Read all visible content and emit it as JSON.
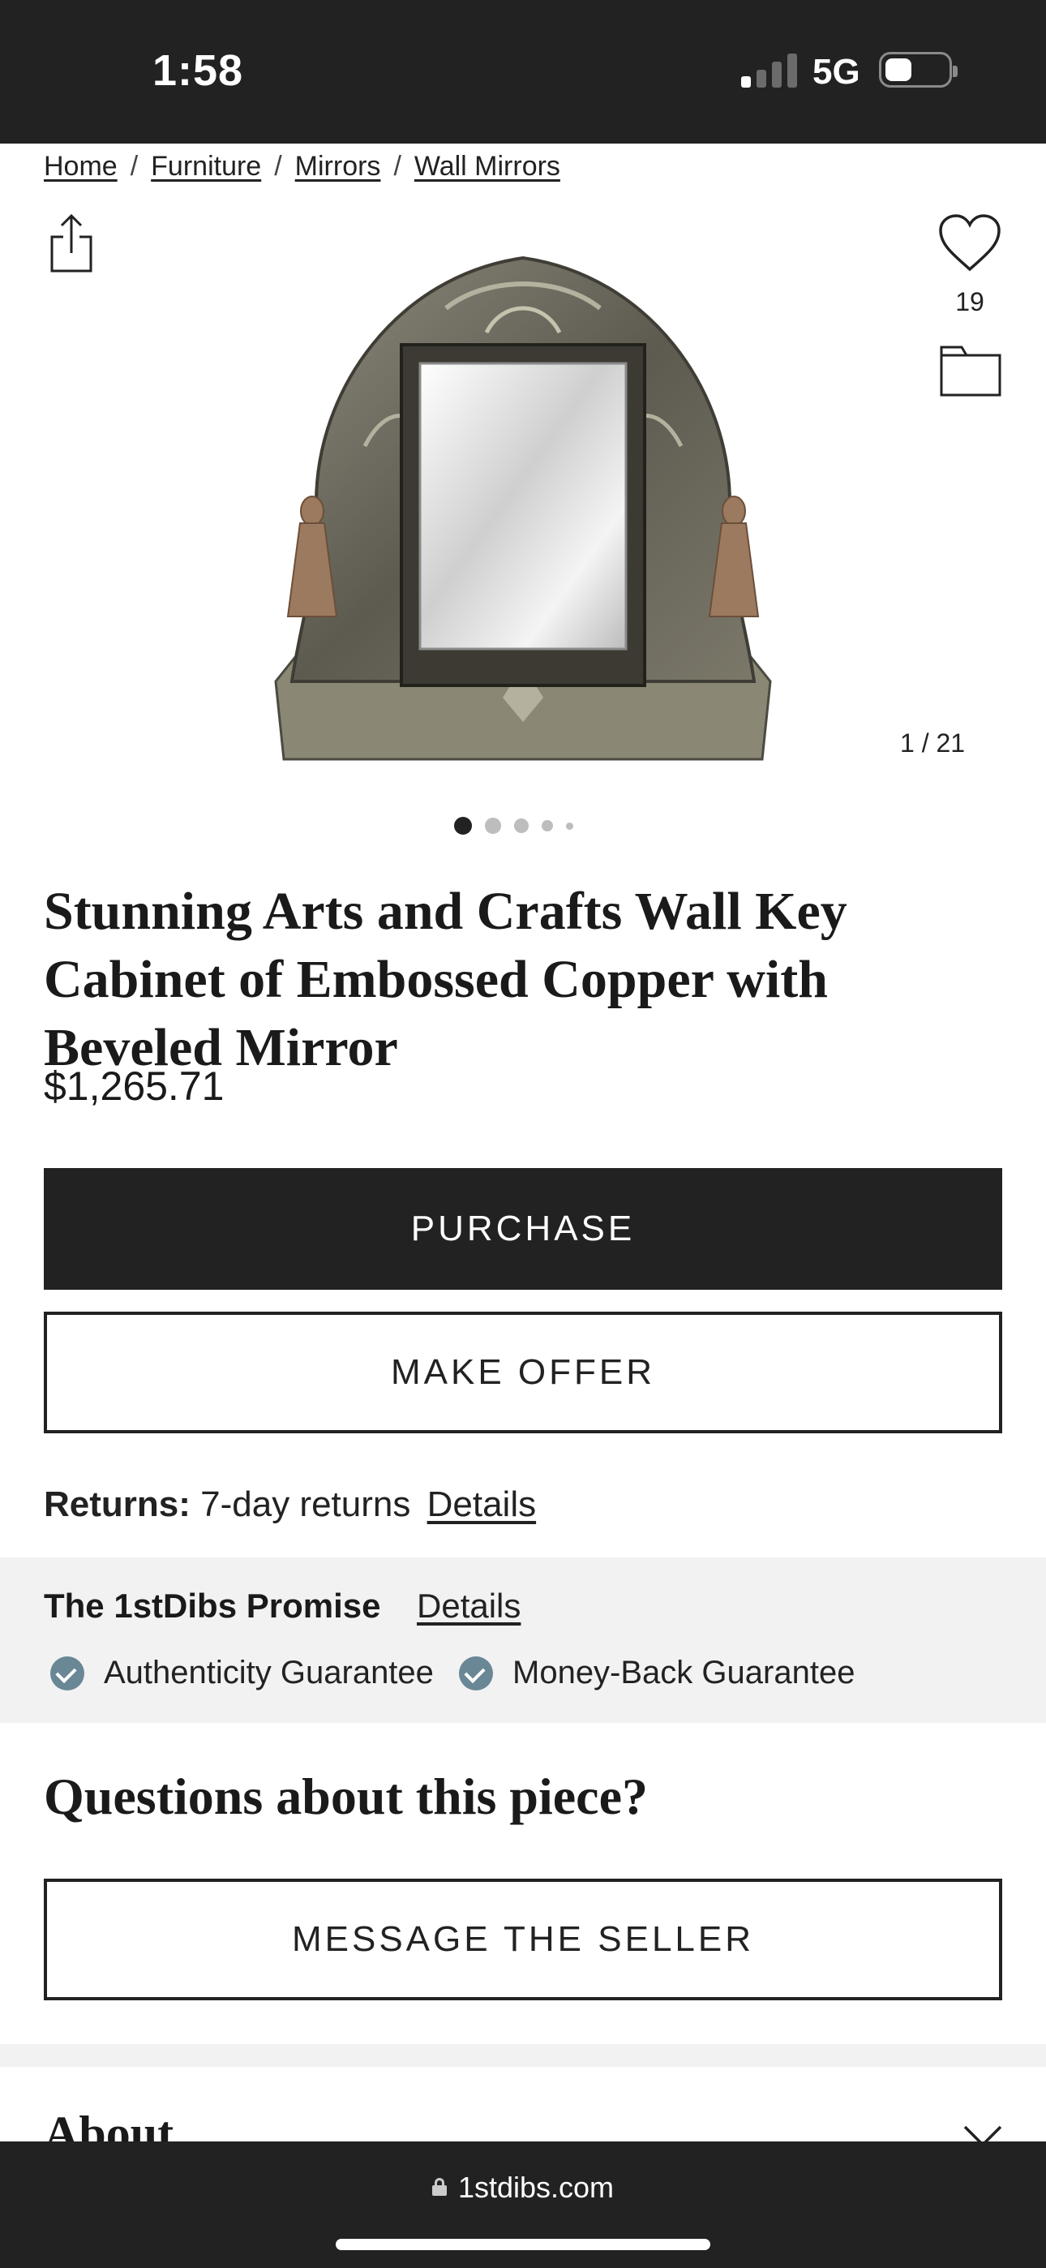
{
  "status_bar": {
    "time": "1:58",
    "network": "5G",
    "signal_bars_active": 1,
    "signal_bars_total": 4
  },
  "breadcrumb": [
    "Home",
    "Furniture",
    "Mirrors",
    "Wall Mirrors"
  ],
  "favorites": {
    "count": "19"
  },
  "gallery": {
    "counter": "1 / 21",
    "dot_count": 5,
    "active_dot": 0
  },
  "product": {
    "title": "Stunning Arts and Crafts Wall Key Cabinet of Embossed Copper with Beveled Mirror",
    "price": "$1,265.71"
  },
  "buttons": {
    "purchase": "PURCHASE",
    "make_offer": "MAKE OFFER",
    "message_seller": "MESSAGE THE SELLER"
  },
  "returns": {
    "label": "Returns:",
    "value": "7-day returns",
    "link": "Details"
  },
  "promise": {
    "title": "The 1stDibs Promise",
    "link": "Details",
    "guarantees": [
      "Authenticity Guarantee",
      "Money-Back Guarantee"
    ]
  },
  "questions_heading": "Questions about this piece?",
  "about_heading": "About",
  "browser": {
    "url": "1stdibs.com"
  },
  "colors": {
    "dark": "#222222",
    "check_badge": "#6a8796",
    "promise_bg": "#f2f2f2"
  },
  "icons": [
    "share-icon",
    "heart-icon",
    "folder-icon",
    "check-icon",
    "chevron-down-icon",
    "lock-icon"
  ]
}
